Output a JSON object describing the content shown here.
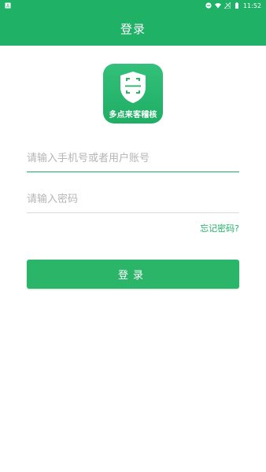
{
  "status_bar": {
    "time": "11:52",
    "icons": [
      "notification-icon",
      "dnd-icon",
      "wifi-icon",
      "signal-icon",
      "battery-icon"
    ]
  },
  "header": {
    "title": "登录"
  },
  "logo": {
    "text": "多点来客稽核",
    "icon": "shield-scan-icon"
  },
  "form": {
    "username_placeholder": "请输入手机号或者用户账号",
    "password_placeholder": "请输入密码",
    "forgot_label": "忘记密码?",
    "login_label": "登录"
  },
  "colors": {
    "primary": "#1fb266",
    "button": "#2bb569"
  }
}
